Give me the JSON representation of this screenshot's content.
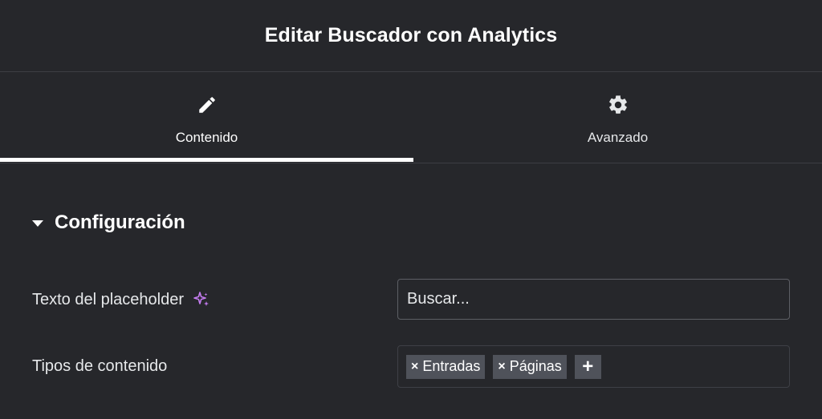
{
  "header": {
    "title": "Editar Buscador con Analytics"
  },
  "tabs": [
    {
      "label": "Contenido",
      "icon": "pencil-icon",
      "active": true
    },
    {
      "label": "Avanzado",
      "icon": "gear-icon",
      "active": false
    }
  ],
  "section": {
    "title": "Configuración",
    "expanded": true
  },
  "fields": {
    "placeholder_text": {
      "label": "Texto del placeholder",
      "value": "Buscar...",
      "ai_icon": "sparkle-icon"
    },
    "content_types": {
      "label": "Tipos de contenido",
      "tags": [
        "Entradas",
        "Páginas"
      ],
      "remove_symbol": "×",
      "add_symbol": "+"
    }
  },
  "colors": {
    "background": "#26272b",
    "text": "#e6e8ea",
    "tag_bg": "#4f525a",
    "ai_accent": "#c47cf0",
    "active_indicator": "#ffffff"
  }
}
